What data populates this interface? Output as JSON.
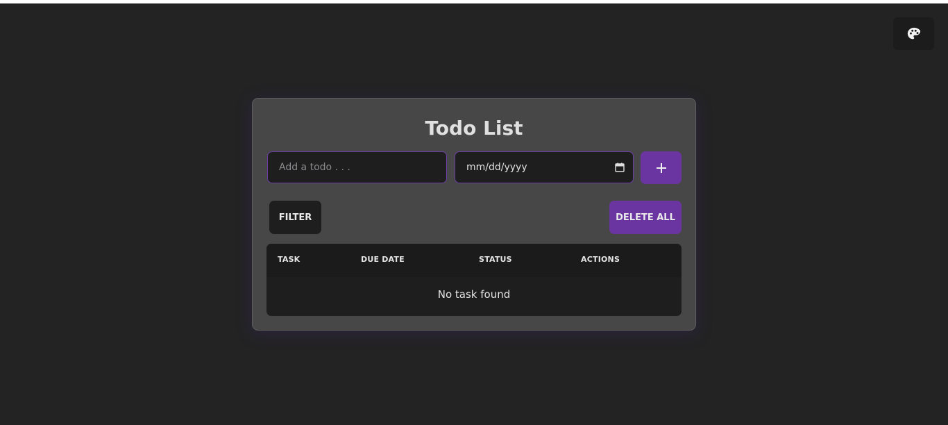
{
  "app": {
    "title": "Todo List"
  },
  "theme_button": {
    "icon": "palette-icon"
  },
  "form": {
    "todo_placeholder": "Add a todo . . .",
    "todo_value": "",
    "date_placeholder": "mm/dd/yyyy",
    "add_label": "+"
  },
  "toolbar": {
    "filter_label": "FILTER",
    "delete_all_label": "DELETE ALL"
  },
  "table": {
    "columns": [
      "TASK",
      "DUE DATE",
      "STATUS",
      "ACTIONS"
    ],
    "rows": [],
    "empty_text": "No task found"
  },
  "colors": {
    "background": "#232324",
    "card": "#474747",
    "accent": "#6a35a0",
    "input_bg": "#1e1e1f"
  }
}
